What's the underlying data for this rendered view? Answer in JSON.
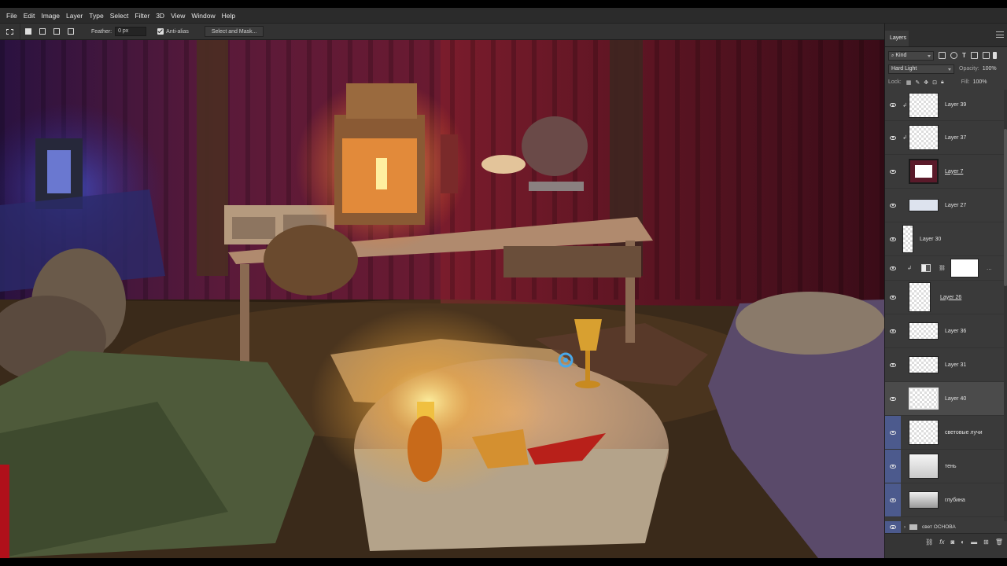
{
  "menu": [
    "File",
    "Edit",
    "Image",
    "Layer",
    "Type",
    "Select",
    "Filter",
    "3D",
    "View",
    "Window",
    "Help"
  ],
  "options": {
    "feather_label": "Feather:",
    "feather_value": "0 px",
    "antialias_label": "Anti-alias",
    "select_mask_label": "Select and Mask..."
  },
  "layers_panel": {
    "tab": "Layers",
    "filter_kind": "Kind",
    "blend_mode": "Hard Light",
    "opacity_label": "Opacity:",
    "opacity_value": "100%",
    "lock_label": "Lock:",
    "fill_label": "Fill:",
    "fill_value": "100%",
    "layers": [
      {
        "name": "Layer 39",
        "clipped": true,
        "selected": false,
        "highlight": false
      },
      {
        "name": "Layer 37",
        "clipped": true,
        "selected": false,
        "highlight": false
      },
      {
        "name": "Layer 7",
        "clipped": false,
        "selected": false,
        "highlight": false
      },
      {
        "name": "Layer 27",
        "clipped": false,
        "selected": false,
        "highlight": false
      },
      {
        "name": "Layer 30",
        "clipped": false,
        "selected": false,
        "highlight": false
      },
      {
        "name": "",
        "clipped": true,
        "selected": false,
        "highlight": false
      },
      {
        "name": "Layer 26",
        "clipped": false,
        "selected": false,
        "highlight": false
      },
      {
        "name": "Layer 36",
        "clipped": false,
        "selected": false,
        "highlight": false
      },
      {
        "name": "Layer 31",
        "clipped": false,
        "selected": false,
        "highlight": false
      },
      {
        "name": "Layer 40",
        "clipped": false,
        "selected": true,
        "highlight": false
      },
      {
        "name": "световые лучи",
        "clipped": false,
        "selected": false,
        "highlight": true
      },
      {
        "name": "тень",
        "clipped": false,
        "selected": false,
        "highlight": true
      },
      {
        "name": "глубина",
        "clipped": false,
        "selected": false,
        "highlight": true
      }
    ],
    "group_name": "свет ОСНОВА"
  }
}
